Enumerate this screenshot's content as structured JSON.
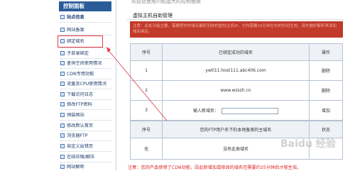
{
  "welcome": "欢迎您使用川航虚大的控制面板",
  "sidebar": {
    "header": "控制面板",
    "items": [
      {
        "label": "站点信息",
        "active": true
      },
      {
        "label": "网站备案"
      },
      {
        "label": "绑定域名"
      },
      {
        "label": "子目录绑定"
      },
      {
        "label": "查询空间使用情况"
      },
      {
        "label": "CDN专用功能"
      },
      {
        "label": "流量及CPU使用情况"
      },
      {
        "label": "下载访问日志"
      },
      {
        "label": "修改FTP密码"
      },
      {
        "label": "预装网站"
      },
      {
        "label": "修改默认首页"
      },
      {
        "label": "浏览器FTP"
      },
      {
        "label": "自定义出错页"
      },
      {
        "label": "在线压缩/解压"
      },
      {
        "label": "网站解密"
      }
    ]
  },
  "main": {
    "title": "虚拟主机自助管理",
    "notice": "注意：此处功能主要，需要把你的域名解析到你的虚拟主机IP，大约需要10分钟左右的时间生效，请先做好解析再添加域名绑定。",
    "table1": {
      "headers": [
        "序号",
        "已绑定成功的域名",
        "操作"
      ],
      "rows": [
        {
          "no": "1",
          "domain": "ywtl11.host111.abc406.com",
          "action": "删除"
        },
        {
          "no": "2",
          "domain": "www.wzszh.cn",
          "action": "删除"
        },
        {
          "no": "3",
          "domain_label": "输入新域名：",
          "action": "增加"
        }
      ]
    },
    "table2": {
      "headers": [
        "序号",
        "您的FTP用户名下的本地备案的主域名",
        "状态"
      ],
      "rows": [
        {
          "no": "无",
          "domain": "没有此类域名",
          "status": ""
        }
      ]
    },
    "footer_note": "注意：您的产品使用了CDN功能，因此新增加或修改的域名在需要约25分钟后才能生效。"
  },
  "watermark": "Baidu 经验",
  "colors": {
    "sidebar_header": "#2b5c9a",
    "notice_bg": "#c23a2a",
    "highlight": "#e4393c"
  }
}
